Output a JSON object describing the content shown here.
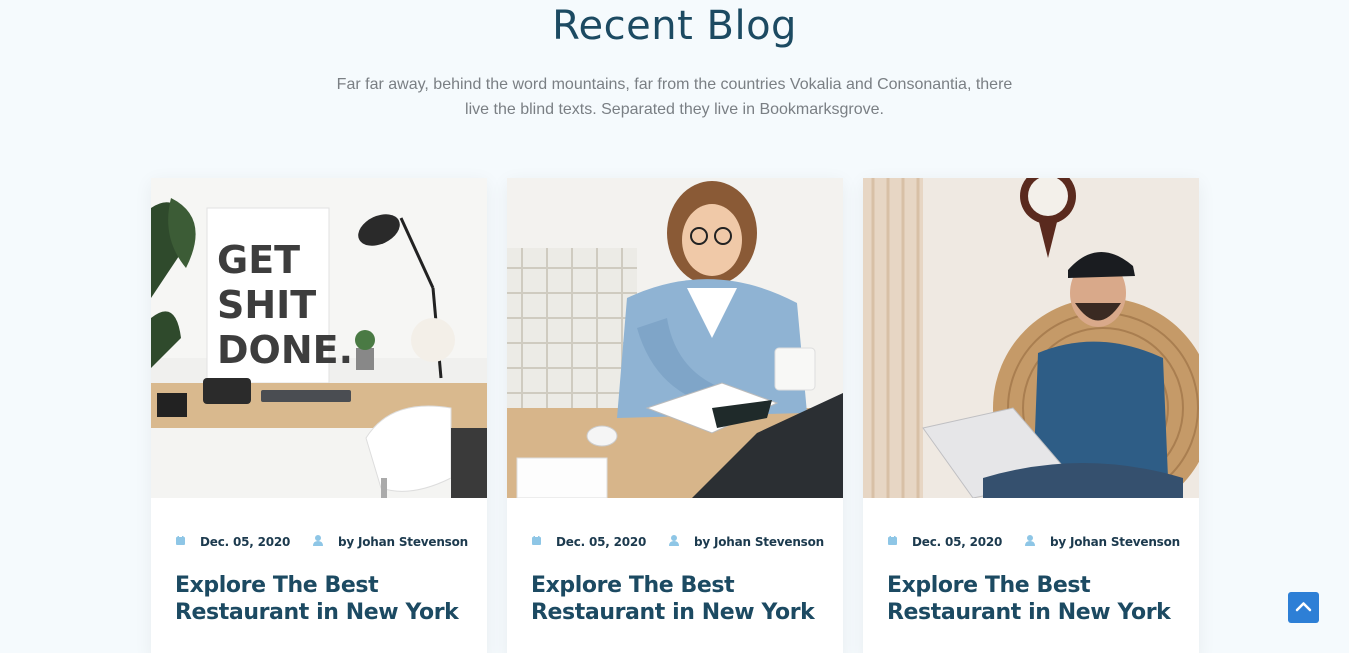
{
  "section": {
    "title": "Recent Blog",
    "subtitle": "Far far away, behind the word mountains, far from the countries Vokalia and Consonantia, there live the blind texts. Separated they live in Bookmarksgrove."
  },
  "posts": [
    {
      "image": "desk-workspace-photo",
      "poster_text": [
        "GET",
        "SHIT",
        "DONE."
      ],
      "date": "Dec. 05, 2020",
      "author": "by Johan Stevenson",
      "title": "Explore The Best Restaurant in New York"
    },
    {
      "image": "woman-writing-notebook-photo",
      "date": "Dec. 05, 2020",
      "author": "by Johan Stevenson",
      "title": "Explore The Best Restaurant in New York"
    },
    {
      "image": "man-with-laptop-photo",
      "date": "Dec. 05, 2020",
      "author": "by Johan Stevenson",
      "title": "Explore The Best Restaurant in New York"
    }
  ],
  "icons": {
    "date": "calendar-icon",
    "author": "user-icon",
    "scroll_top": "chevron-up-icon"
  },
  "colors": {
    "background": "#f5fafd",
    "heading": "#1c4a62",
    "accent": "#8ec6e6",
    "scroll_top": "#2d7fd6"
  }
}
